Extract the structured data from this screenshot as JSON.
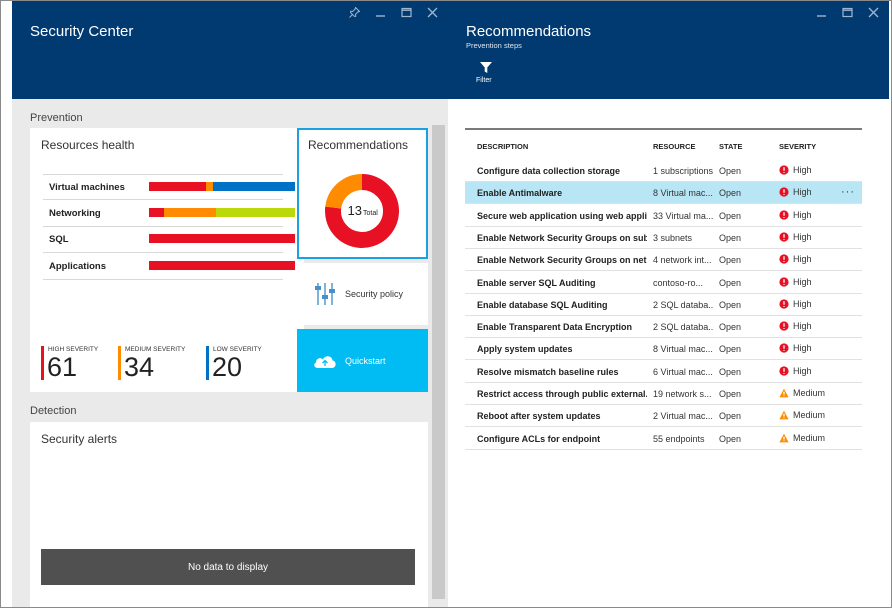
{
  "colors": {
    "header_bg": "#003a70",
    "high": "#e81123",
    "medium": "#ff8c00",
    "low": "#0072c6",
    "low_green": "#bad80a",
    "quickstart_bg": "#00bcf2",
    "selected_row": "#b8e6f5"
  },
  "left": {
    "title": "Security Center",
    "prevention_label": "Prevention",
    "resources_health": {
      "title": "Resources health",
      "rows": [
        {
          "label": "Virtual machines",
          "segments": [
            {
              "color": "#e81123",
              "frac": 0.39
            },
            {
              "color": "#ff8c00",
              "frac": 0.05
            },
            {
              "color": "#0072c6",
              "frac": 0.56
            }
          ]
        },
        {
          "label": "Networking",
          "segments": [
            {
              "color": "#e81123",
              "frac": 0.1
            },
            {
              "color": "#ff8c00",
              "frac": 0.36
            },
            {
              "color": "#bad80a",
              "frac": 0.54
            }
          ]
        },
        {
          "label": "SQL",
          "segments": [
            {
              "color": "#e81123",
              "frac": 1.0
            }
          ]
        },
        {
          "label": "Applications",
          "segments": [
            {
              "color": "#e81123",
              "frac": 1.0
            }
          ]
        }
      ],
      "severity": [
        {
          "label": "HIGH SEVERITY",
          "value": "61",
          "color": "#e81123"
        },
        {
          "label": "MEDIUM SEVERITY",
          "value": "34",
          "color": "#ff8c00"
        },
        {
          "label": "LOW SEVERITY",
          "value": "20",
          "color": "#0072c6"
        }
      ]
    },
    "recommendations_tile": {
      "title": "Recommendations",
      "donut": {
        "total": "13",
        "total_label": "Total",
        "high": 10,
        "medium": 3
      }
    },
    "security_policy_tile": {
      "label": "Security policy",
      "icon": "sliders-icon"
    },
    "quickstart_tile": {
      "label": "Quickstart",
      "icon": "cloud-icon"
    },
    "detection_label": "Detection",
    "security_alerts": {
      "title": "Security alerts",
      "empty_text": "No data to display"
    }
  },
  "right": {
    "title": "Recommendations",
    "subtitle": "Prevention steps",
    "filter_label": "Filter",
    "columns": [
      "DESCRIPTION",
      "RESOURCE",
      "STATE",
      "SEVERITY"
    ],
    "rows": [
      {
        "description": "Configure data collection storage",
        "resource": "1 subscriptions",
        "state": "Open",
        "severity": "High"
      },
      {
        "description": "Enable Antimalware",
        "resource": "8 Virtual mac...",
        "state": "Open",
        "severity": "High",
        "selected": true
      },
      {
        "description": "Secure web application using web appli...",
        "resource": "33 Virtual ma...",
        "state": "Open",
        "severity": "High"
      },
      {
        "description": "Enable Network Security Groups on sub...",
        "resource": "3 subnets",
        "state": "Open",
        "severity": "High"
      },
      {
        "description": "Enable Network Security Groups on net...",
        "resource": "4 network int...",
        "state": "Open",
        "severity": "High"
      },
      {
        "description": "Enable server SQL Auditing",
        "resource": "contoso-ro...",
        "state": "Open",
        "severity": "High"
      },
      {
        "description": "Enable database SQL Auditing",
        "resource": "2 SQL databa...",
        "state": "Open",
        "severity": "High"
      },
      {
        "description": "Enable Transparent Data Encryption",
        "resource": "2 SQL databa...",
        "state": "Open",
        "severity": "High"
      },
      {
        "description": "Apply system updates",
        "resource": "8 Virtual mac...",
        "state": "Open",
        "severity": "High"
      },
      {
        "description": "Resolve mismatch baseline rules",
        "resource": "6 Virtual mac...",
        "state": "Open",
        "severity": "High"
      },
      {
        "description": "Restrict access through public external...",
        "resource": "19 network s...",
        "state": "Open",
        "severity": "Medium"
      },
      {
        "description": "Reboot after system updates",
        "resource": "2 Virtual mac...",
        "state": "Open",
        "severity": "Medium"
      },
      {
        "description": "Configure ACLs for endpoint",
        "resource": "55 endpoints",
        "state": "Open",
        "severity": "Medium"
      }
    ],
    "row_menu_label": "···"
  }
}
